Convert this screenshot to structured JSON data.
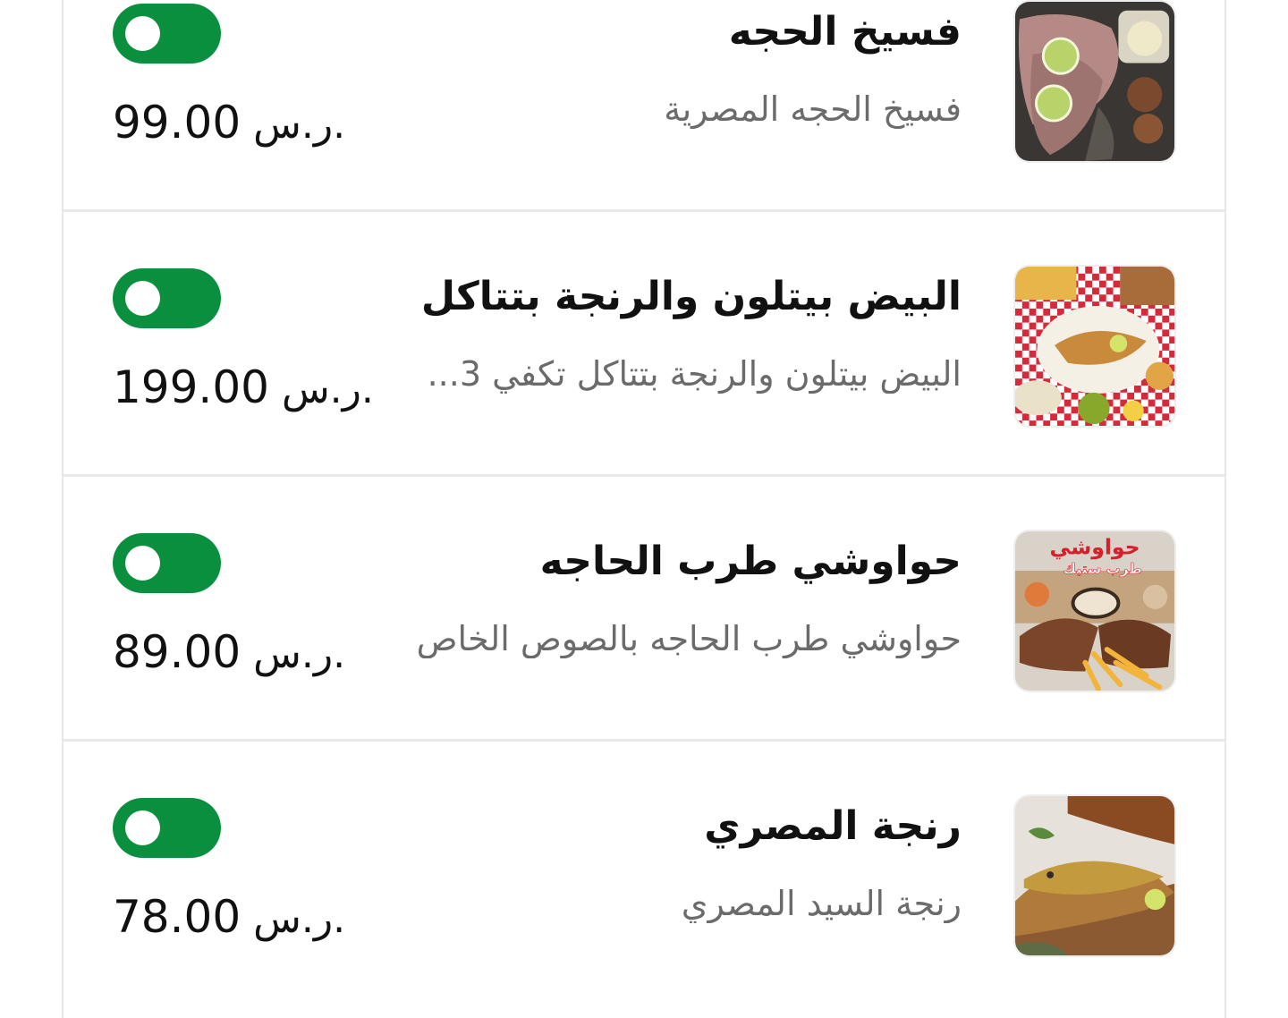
{
  "items": [
    {
      "title": "فسيخ الحجه",
      "description": "فسيخ الحجه المصرية",
      "currency": "ر.س.",
      "price": "99.00",
      "enabled": true,
      "image_icon": "fesikh-dish-photo"
    },
    {
      "title": "البيض بيتلون والرنجة بتتاكل",
      "description": "البيض بيتلون والرنجة بتتاكل تكفي 3...",
      "currency": "ر.س.",
      "price": "199.00",
      "enabled": true,
      "image_icon": "herring-platter-photo"
    },
    {
      "title": "حواوشي طرب الحاجه",
      "description": "حواوشي طرب الحاجه بالصوص الخاص",
      "currency": "ر.س.",
      "price": "89.00",
      "enabled": true,
      "image_icon": "hawawshi-photo",
      "image_text": [
        "حواوشي",
        "طرب ستيك"
      ]
    },
    {
      "title": "رنجة المصري",
      "description": "رنجة السيد المصري",
      "currency": "ر.س.",
      "price": "78.00",
      "enabled": true,
      "image_icon": "smoked-herring-photo"
    }
  ],
  "colors": {
    "toggle_on": "#0a8f3f",
    "title": "#111111",
    "description": "#6b6b6b",
    "divider": "#e9e9e9"
  }
}
